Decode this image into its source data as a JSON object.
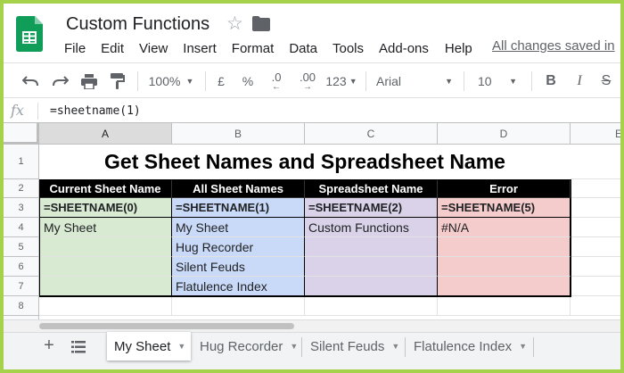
{
  "app": {
    "doc_title": "Custom Functions",
    "save_status": "All changes saved in",
    "menu": [
      "File",
      "Edit",
      "View",
      "Insert",
      "Format",
      "Data",
      "Tools",
      "Add-ons",
      "Help"
    ]
  },
  "toolbar": {
    "zoom": "100%",
    "currency": "£",
    "percent": "%",
    "decrease_decimal": ".0",
    "increase_decimal": ".00",
    "more_formats": "123",
    "font": "Arial",
    "font_size": "10",
    "bold": "B",
    "italic": "I",
    "strike": "S"
  },
  "formula_bar": {
    "fx": "fx",
    "formula": "=sheetname(1)"
  },
  "grid": {
    "columns": [
      "A",
      "B",
      "C",
      "D",
      "E"
    ],
    "rows": [
      "1",
      "2",
      "3",
      "4",
      "5",
      "6",
      "7",
      "8"
    ],
    "title": "Get Sheet Names and Spreadsheet Name",
    "headers": [
      "Current Sheet Name",
      "All Sheet Names",
      "Spreadsheet Name",
      "Error"
    ],
    "formulas": [
      "=SHEETNAME(0)",
      "=SHEETNAME(1)",
      "=SHEETNAME(2)",
      "=SHEETNAME(5)"
    ],
    "values": {
      "A4": "My Sheet",
      "B4": "My Sheet",
      "B5": "Hug Recorder",
      "B6": "Silent Feuds",
      "B7": "Flatulence Index",
      "C4": "Custom Functions",
      "D4": "#N/A"
    },
    "colors": {
      "current": "#d9ead3",
      "all": "#c9daf8",
      "spreadsheet": "#d9d2e9",
      "error": "#f4cccc",
      "header_bg": "#000000"
    }
  },
  "tabs": {
    "add": "+",
    "sheets": [
      "My Sheet",
      "Hug Recorder",
      "Silent Feuds",
      "Flatulence Index"
    ],
    "active": "My Sheet"
  },
  "brand": {
    "sheets_green": "#0f9d58",
    "frame_green": "#a6d14a"
  }
}
